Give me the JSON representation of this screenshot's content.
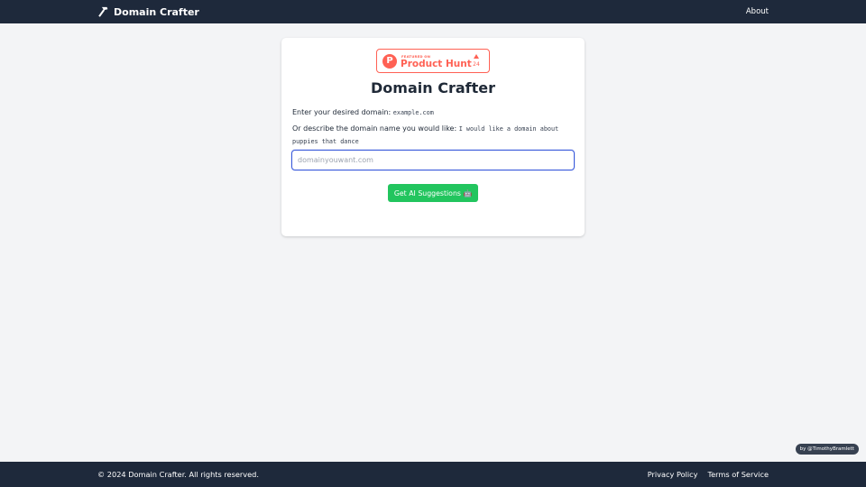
{
  "nav": {
    "brand_label": "Domain Crafter",
    "brand_icon": "hammer-icon",
    "about_label": "About"
  },
  "product_hunt": {
    "featured_label": "FEATURED ON",
    "name": "Product Hunt",
    "upvotes": "24",
    "color": "#ff6154"
  },
  "main": {
    "title": "Domain Crafter",
    "instruction_1": "Enter your desired domain: ",
    "instruction_1_example": "example.com",
    "instruction_2": "Or describe the domain name you would like: ",
    "instruction_2_example": "I would like a domain about puppies that dance",
    "input": {
      "value": "",
      "placeholder": "domainyouwant.com"
    },
    "suggest_button_label": "Get AI Suggestions 🤖"
  },
  "author_badge": "by @TimothyBramlett",
  "footer": {
    "copyright": "© 2024 Domain Crafter. All rights reserved.",
    "links": [
      "Privacy Policy",
      "Terms of Service"
    ]
  },
  "colors": {
    "nav_bg": "#1e293b",
    "page_bg": "#f3f4f6",
    "button": "#22c55e",
    "input_focus": "#3b5bdb"
  }
}
